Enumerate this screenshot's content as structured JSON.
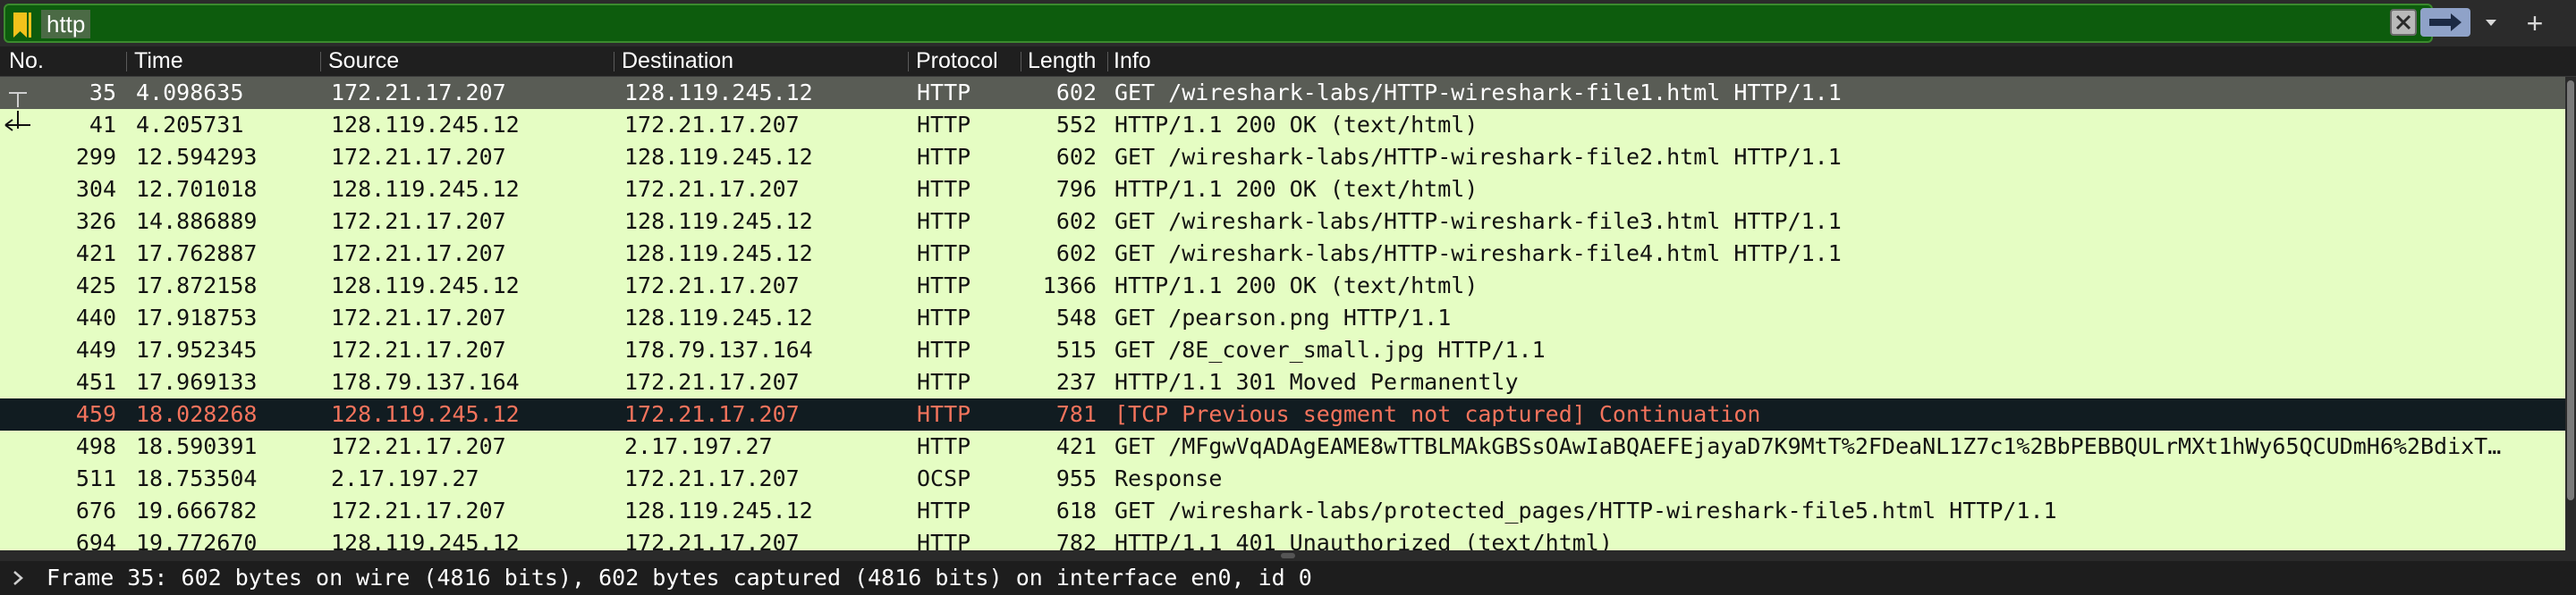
{
  "filter": {
    "value": "http",
    "bookmark_icon": "bookmark-icon",
    "clear_icon": "clear-icon",
    "apply_icon": "apply-arrow-icon",
    "dropdown_icon": "chevron-down-icon",
    "plus_icon": "plus-icon",
    "plus_label": "+",
    "accent": "#0d5c0d"
  },
  "columns": {
    "no": "No.",
    "time": "Time",
    "source": "Source",
    "destination": "Destination",
    "protocol": "Protocol",
    "length": "Length",
    "info": "Info"
  },
  "colors": {
    "row_http": "#e5fdc3",
    "row_selected": "#595c55",
    "row_error_bg": "#111c21",
    "row_error_fg": "#f4735c"
  },
  "packets": [
    {
      "no": "35",
      "time": "4.098635",
      "source": "172.21.17.207",
      "destination": "128.119.245.12",
      "protocol": "HTTP",
      "length": "602",
      "info": "GET /wireshark-labs/HTTP-wireshark-file1.html HTTP/1.1",
      "state": "selected"
    },
    {
      "no": "41",
      "time": "4.205731",
      "source": "128.119.245.12",
      "destination": "172.21.17.207",
      "protocol": "HTTP",
      "length": "552",
      "info": "HTTP/1.1 200 OK  (text/html)",
      "state": "normal"
    },
    {
      "no": "299",
      "time": "12.594293",
      "source": "172.21.17.207",
      "destination": "128.119.245.12",
      "protocol": "HTTP",
      "length": "602",
      "info": "GET /wireshark-labs/HTTP-wireshark-file2.html HTTP/1.1",
      "state": "normal"
    },
    {
      "no": "304",
      "time": "12.701018",
      "source": "128.119.245.12",
      "destination": "172.21.17.207",
      "protocol": "HTTP",
      "length": "796",
      "info": "HTTP/1.1 200 OK  (text/html)",
      "state": "normal"
    },
    {
      "no": "326",
      "time": "14.886889",
      "source": "172.21.17.207",
      "destination": "128.119.245.12",
      "protocol": "HTTP",
      "length": "602",
      "info": "GET /wireshark-labs/HTTP-wireshark-file3.html HTTP/1.1",
      "state": "normal"
    },
    {
      "no": "421",
      "time": "17.762887",
      "source": "172.21.17.207",
      "destination": "128.119.245.12",
      "protocol": "HTTP",
      "length": "602",
      "info": "GET /wireshark-labs/HTTP-wireshark-file4.html HTTP/1.1",
      "state": "normal"
    },
    {
      "no": "425",
      "time": "17.872158",
      "source": "128.119.245.12",
      "destination": "172.21.17.207",
      "protocol": "HTTP",
      "length": "1366",
      "info": "HTTP/1.1 200 OK  (text/html)",
      "state": "normal"
    },
    {
      "no": "440",
      "time": "17.918753",
      "source": "172.21.17.207",
      "destination": "128.119.245.12",
      "protocol": "HTTP",
      "length": "548",
      "info": "GET /pearson.png HTTP/1.1",
      "state": "normal"
    },
    {
      "no": "449",
      "time": "17.952345",
      "source": "172.21.17.207",
      "destination": "178.79.137.164",
      "protocol": "HTTP",
      "length": "515",
      "info": "GET /8E_cover_small.jpg HTTP/1.1",
      "state": "normal"
    },
    {
      "no": "451",
      "time": "17.969133",
      "source": "178.79.137.164",
      "destination": "172.21.17.207",
      "protocol": "HTTP",
      "length": "237",
      "info": "HTTP/1.1 301 Moved Permanently",
      "state": "normal"
    },
    {
      "no": "459",
      "time": "18.028268",
      "source": "128.119.245.12",
      "destination": "172.21.17.207",
      "protocol": "HTTP",
      "length": "781",
      "info": "[TCP Previous segment not captured] Continuation",
      "state": "error"
    },
    {
      "no": "498",
      "time": "18.590391",
      "source": "172.21.17.207",
      "destination": "2.17.197.27",
      "protocol": "HTTP",
      "length": "421",
      "info": "GET /MFgwVqADAgEAME8wTTBLMAkGBSsOAwIaBQAEFEjayaD7K9MtT%2FDeaNL1Z7c1%2BbPEBBQULrMXt1hWy65QCUDmH6%2BdixT…",
      "state": "normal"
    },
    {
      "no": "511",
      "time": "18.753504",
      "source": "2.17.197.27",
      "destination": "172.21.17.207",
      "protocol": "OCSP",
      "length": "955",
      "info": "Response",
      "state": "normal"
    },
    {
      "no": "676",
      "time": "19.666782",
      "source": "172.21.17.207",
      "destination": "128.119.245.12",
      "protocol": "HTTP",
      "length": "618",
      "info": "GET /wireshark-labs/protected_pages/HTTP-wireshark-file5.html HTTP/1.1",
      "state": "normal"
    },
    {
      "no": "694",
      "time": "19.772670",
      "source": "128.119.245.12",
      "destination": "172.21.17.207",
      "protocol": "HTTP",
      "length": "782",
      "info": "HTTP/1.1 401 Unauthorized  (text/html)",
      "state": "normal"
    }
  ],
  "details": {
    "expand_icon": "chevron-right-icon",
    "summary": "Frame 35: 602 bytes on wire (4816 bits), 602 bytes captured (4816 bits) on interface en0, id 0"
  }
}
